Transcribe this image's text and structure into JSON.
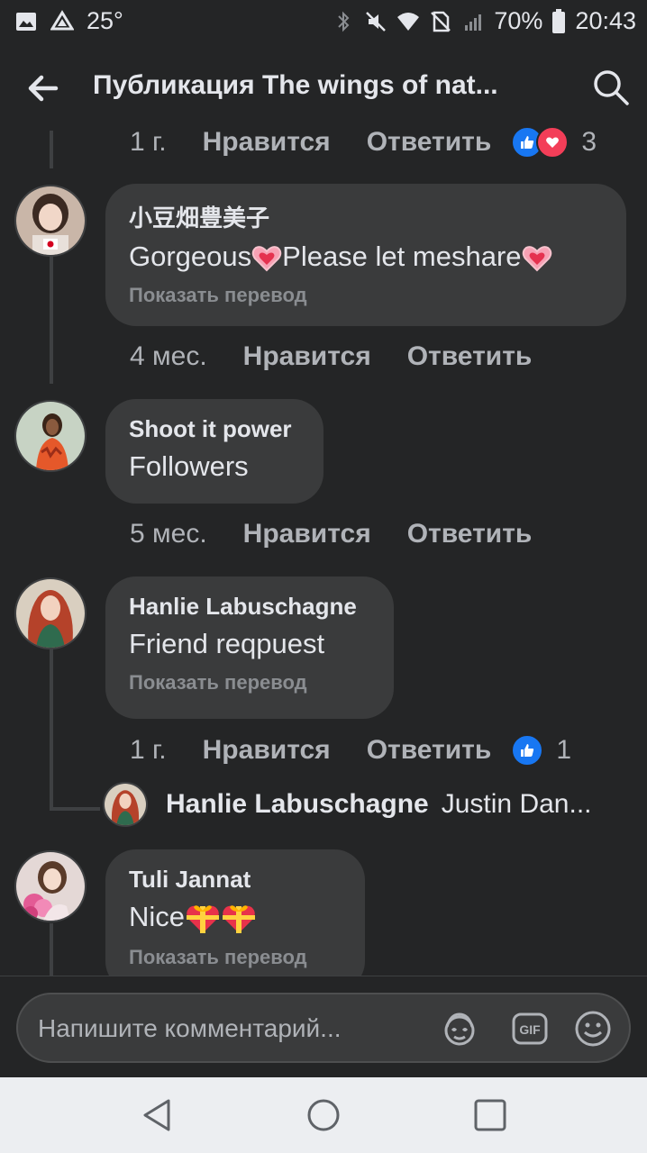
{
  "status_bar": {
    "temperature": "25°",
    "battery": "70%",
    "time": "20:43"
  },
  "header": {
    "title": "Публикация The wings of nat..."
  },
  "top_meta": {
    "time": "1 г.",
    "like": "Нравится",
    "reply": "Ответить",
    "reaction_count": "3"
  },
  "comments": [
    {
      "name": "小豆畑豊美子",
      "text_parts": [
        "Gorgeous",
        "Please let meshare"
      ],
      "translate": "Показать перевод",
      "time": "4 мес.",
      "like": "Нравится",
      "reply": "Ответить"
    },
    {
      "name": "Shoot it power",
      "text": "Followers",
      "time": "5 мес.",
      "like": "Нравится",
      "reply": "Ответить"
    },
    {
      "name": "Hanlie Labuschagne",
      "text": "Friend reqpuest",
      "translate": "Показать перевод",
      "time": "1 г.",
      "like": "Нравится",
      "reply": "Ответить",
      "reaction_count": "1",
      "reply_preview": {
        "name": "Hanlie Labuschagne",
        "text": "Justin Dan..."
      }
    },
    {
      "name": "Tuli Jannat",
      "text": "Nice",
      "translate": "Показать перевод"
    }
  ],
  "composer": {
    "placeholder": "Напишите комментарий..."
  },
  "colors": {
    "background": "#242526",
    "bubble": "#3a3b3c",
    "like_blue": "#1877f2",
    "love_red": "#f33e58"
  }
}
